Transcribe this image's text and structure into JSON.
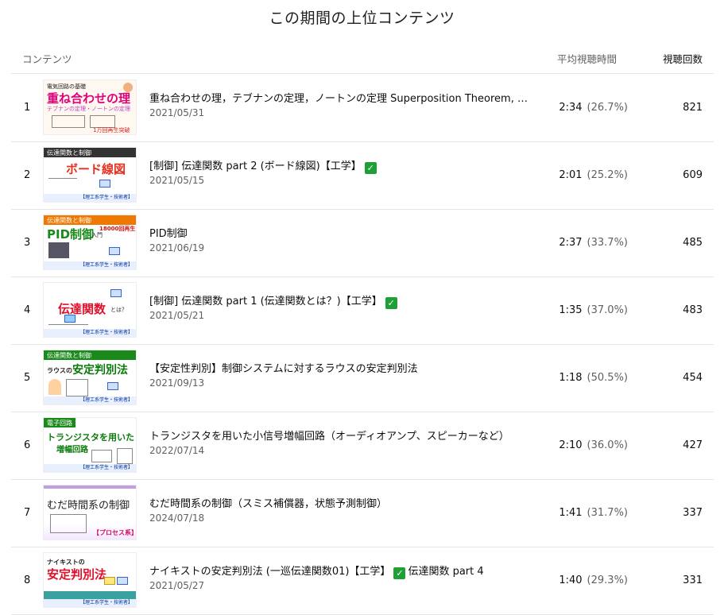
{
  "page_title": "この期間の上位コンテンツ",
  "columns": {
    "content": "コンテンツ",
    "avg_view_duration": "平均視聴時間",
    "views": "視聴回数"
  },
  "rows": [
    {
      "rank": "1",
      "title": "重ね合わせの理，テブナンの定理，ノートンの定理 Superposition Theorem, ThL...",
      "verified": false,
      "date": "2021/05/31",
      "avg": "2:34",
      "pct": "(26.7%)",
      "views": "821",
      "thumb": {
        "top": "電気回路の基礎",
        "head": "重ね合わせの理",
        "sub": "テブナンの定理・ノートンの定理",
        "foot": "1万回再生突破"
      }
    },
    {
      "rank": "2",
      "title_a": "[制御] 伝達関数 part 2 (ボード線図)【工学】",
      "verified": true,
      "date": "2021/05/15",
      "avg": "2:01",
      "pct": "(25.2%)",
      "views": "609",
      "thumb": {
        "top": "伝達関数と制御",
        "head": "ボード線図",
        "foot": "【理工系学生・技術者】"
      }
    },
    {
      "rank": "3",
      "title": "PID制御",
      "verified": false,
      "date": "2021/06/19",
      "avg": "2:37",
      "pct": "(33.7%)",
      "views": "485",
      "thumb": {
        "top": "伝達関数と制御",
        "head": "PID制御",
        "sub": "入門",
        "badge": "18000回再生",
        "foot": "【理工系学生・技術者】"
      }
    },
    {
      "rank": "4",
      "title_a": "[制御] 伝達関数 part 1 (伝達関数とは？)【工学】",
      "verified": true,
      "date": "2021/05/21",
      "avg": "1:35",
      "pct": "(37.0%)",
      "views": "483",
      "thumb": {
        "head": "伝達関数",
        "sub": "とは？",
        "foot": "【理工系学生・技術者】"
      }
    },
    {
      "rank": "5",
      "title": "【安定性判別】制御システムに対するラウスの安定判別法",
      "verified": false,
      "date": "2021/09/13",
      "avg": "1:18",
      "pct": "(50.5%)",
      "views": "454",
      "thumb": {
        "top": "伝達関数と制御",
        "head": "安定判別法",
        "sub": "ラウスの",
        "foot": "【理工系学生・技術者】"
      }
    },
    {
      "rank": "6",
      "title": "トランジスタを用いた小信号増幅回路（オーディオアンプ、スピーカーなど）",
      "verified": false,
      "date": "2022/07/14",
      "avg": "2:10",
      "pct": "(36.0%)",
      "views": "427",
      "thumb": {
        "top": "電子回路",
        "head": "トランジスタを用いた",
        "sub": "増幅回路",
        "foot": "【理工系学生・技術者】"
      }
    },
    {
      "rank": "7",
      "title": "むだ時間系の制御（スミス補償器，状態予測制御）",
      "verified": false,
      "date": "2024/07/18",
      "avg": "1:41",
      "pct": "(31.7%)",
      "views": "337",
      "thumb": {
        "head": "むだ時間系の制御",
        "badge": "【プロセス系】"
      }
    },
    {
      "rank": "8",
      "title_a": "ナイキストの安定判別法 (一巡伝達関数01)【工学】",
      "title_b": "伝達関数 part 4",
      "verified": true,
      "date": "2021/05/27",
      "avg": "1:40",
      "pct": "(29.3%)",
      "views": "331",
      "thumb": {
        "top": "ナイキストの",
        "head": "安定判別法",
        "foot": "【理工系学生・技術者】"
      }
    }
  ],
  "colors": {
    "verified": "#1fa037",
    "divider": "#e5e5e5",
    "muted_text": "#606060"
  },
  "icons": {
    "verified": "check-mark-button-icon"
  }
}
